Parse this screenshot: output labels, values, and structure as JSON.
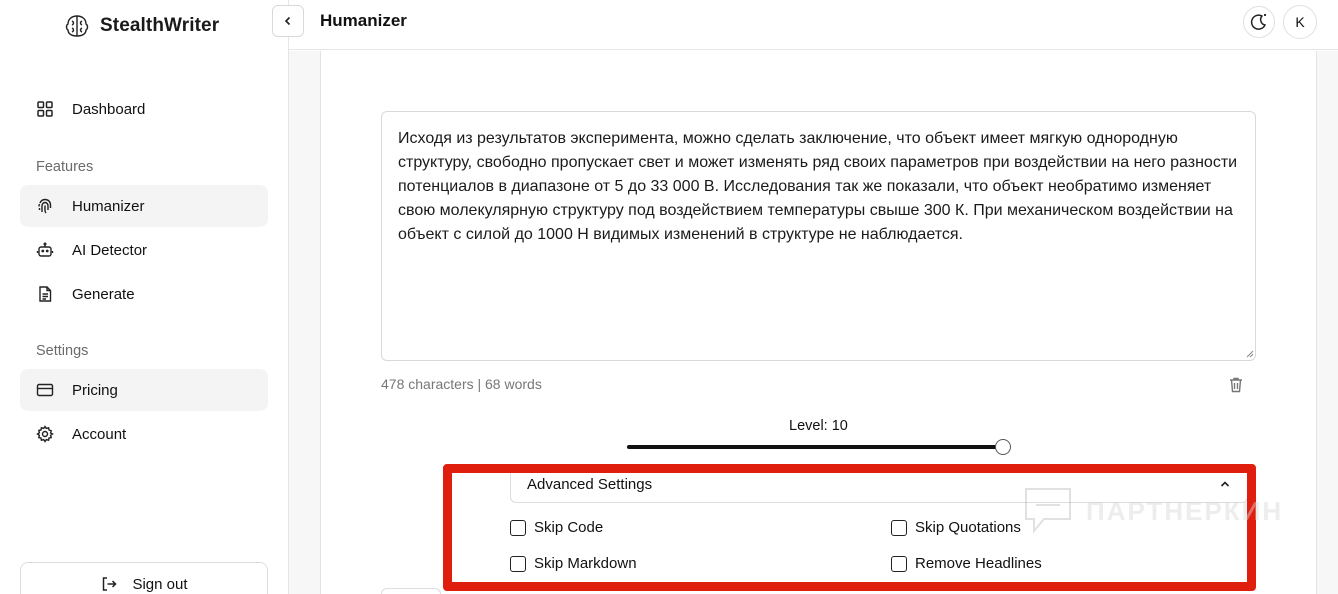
{
  "brand": {
    "name": "StealthWriter"
  },
  "sidebar": {
    "dashboard_label": "Dashboard",
    "features_label": "Features",
    "features": [
      {
        "label": "Humanizer",
        "icon": "fingerprint-icon",
        "active": true
      },
      {
        "label": "AI Detector",
        "icon": "robot-icon",
        "active": false
      },
      {
        "label": "Generate",
        "icon": "document-icon",
        "active": false
      }
    ],
    "settings_label": "Settings",
    "settings": [
      {
        "label": "Pricing",
        "icon": "credit-card-icon",
        "active": true
      },
      {
        "label": "Account",
        "icon": "gear-icon",
        "active": false
      }
    ],
    "signout_label": "Sign out"
  },
  "header": {
    "title": "Humanizer",
    "avatar_initial": "K"
  },
  "editor": {
    "text": "Исходя из результатов эксперимента, можно сделать заключение, что объект имеет мягкую однородную структуру, свободно пропускает свет и может изменять ряд своих параметров при воздействии на него разности потенциалов в диапазоне от 5 до 33 000 В. Исследования так же показали, что объект необратимо изменяет свою молекулярную структуру под воздействием температуры свыше 300 К. При механическом воздействии на объект с силой до 1000 Н видимых изменений в структуре не наблюдается.",
    "stats": "478 characters | 68 words"
  },
  "level": {
    "label": "Level: 10",
    "value": 10,
    "max": 10
  },
  "advanced": {
    "title": "Advanced Settings",
    "options": {
      "skip_code": "Skip Code",
      "skip_quotations": "Skip Quotations",
      "skip_markdown": "Skip Markdown",
      "remove_headlines": "Remove Headlines"
    }
  },
  "watermark": {
    "text": "ПАРТНЕРКИН"
  },
  "colors": {
    "highlight": "#e01e0e",
    "active_bg": "#f4f4f4"
  }
}
